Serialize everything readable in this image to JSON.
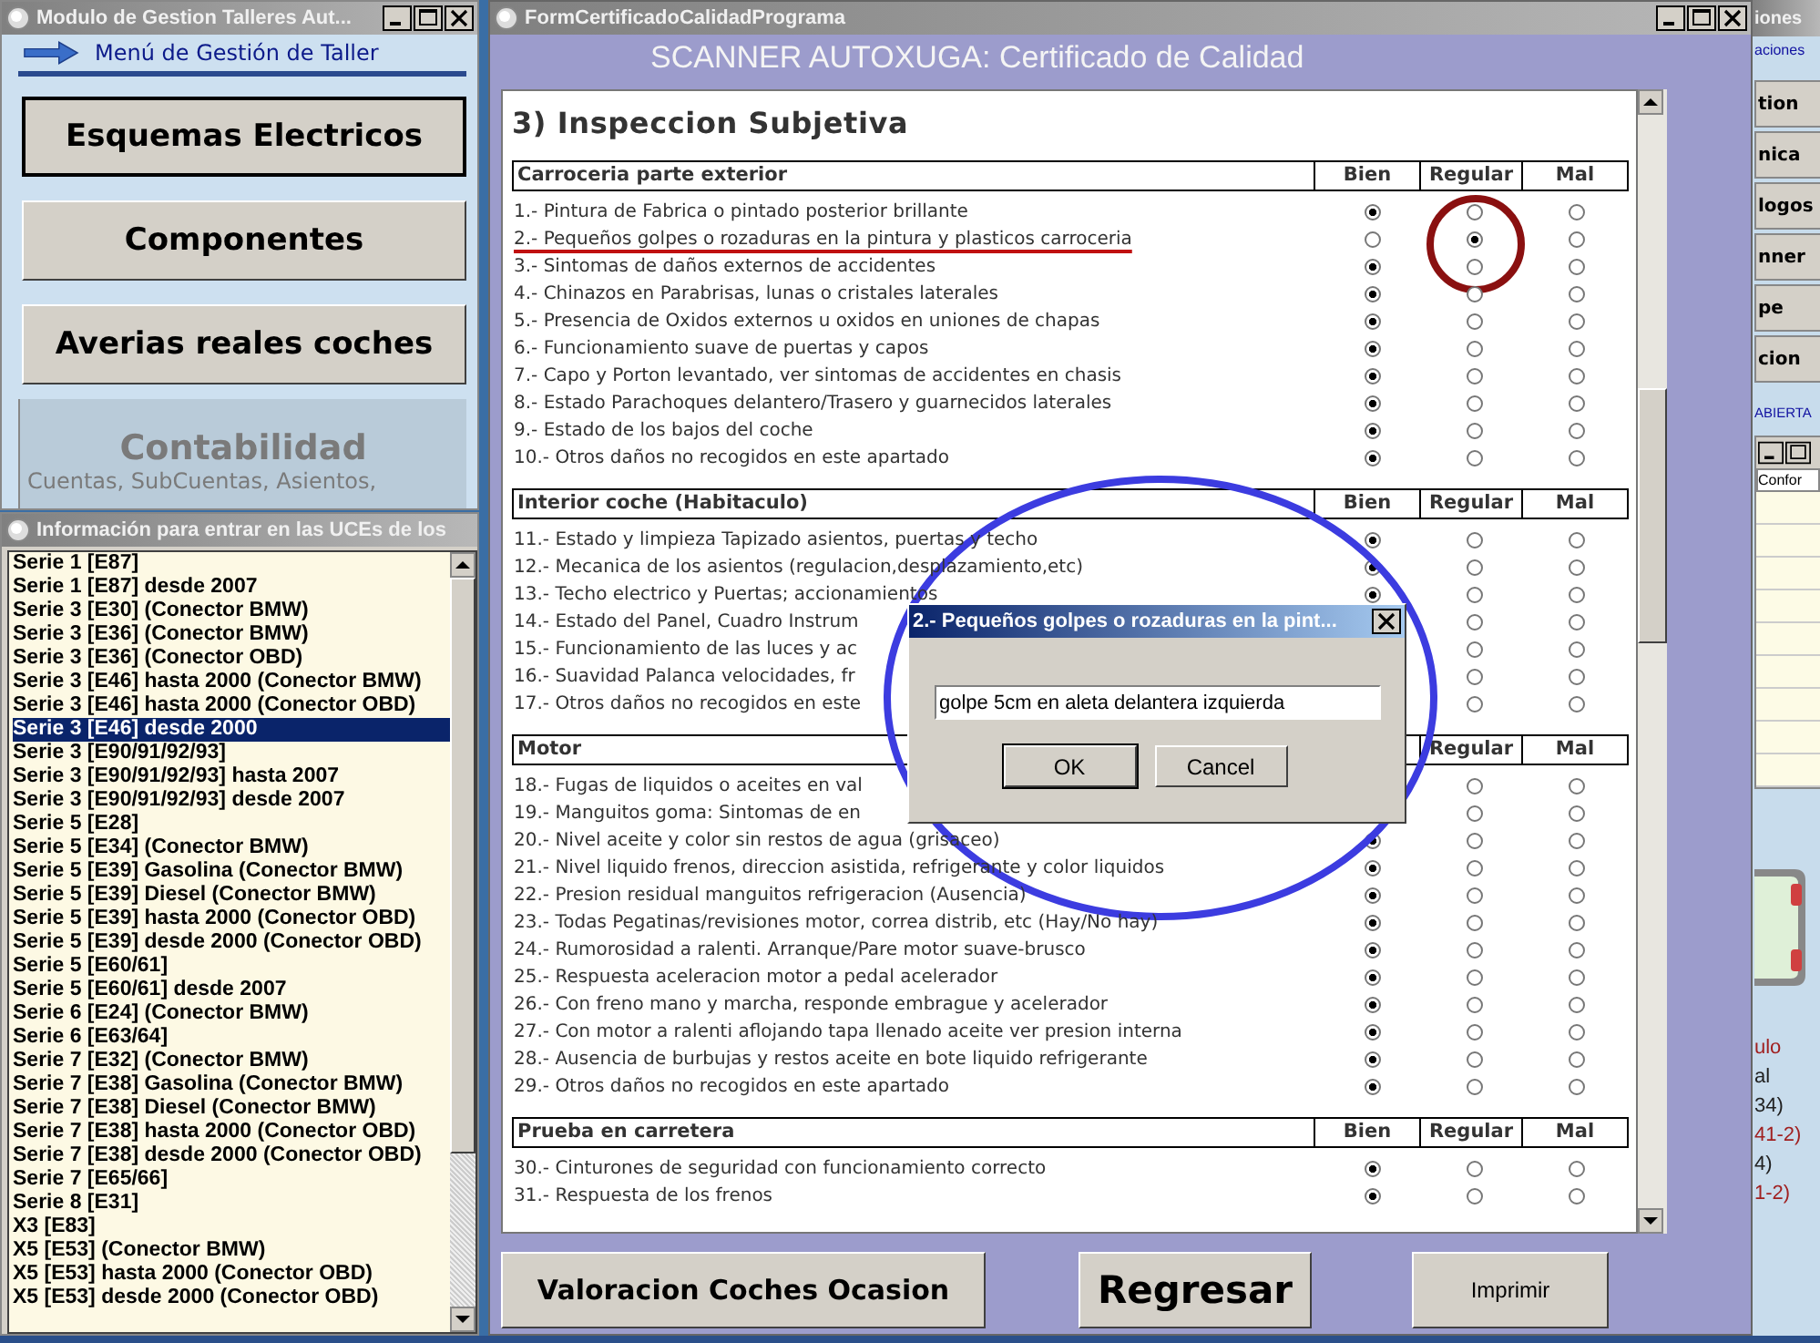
{
  "menu_window": {
    "title": "Modulo de Gestion Talleres Aut...",
    "heading": "Menú de Gestión de Taller",
    "buttons": [
      "Esquemas Electricos",
      "Componentes",
      "Averias reales coches"
    ],
    "section_title": "Contabilidad",
    "section_text": "Cuentas, SubCuentas, Asientos,"
  },
  "models_window": {
    "title": "Información para entrar en las UCEs de los",
    "items": [
      {
        "label": "Serie 1 [E87]",
        "selected": false
      },
      {
        "label": "Serie 1 [E87] desde 2007",
        "selected": false
      },
      {
        "label": "Serie 3 [E30] (Conector BMW)",
        "selected": false
      },
      {
        "label": "Serie 3 [E36] (Conector BMW)",
        "selected": false
      },
      {
        "label": "Serie 3 [E36] (Conector OBD)",
        "selected": false
      },
      {
        "label": "Serie 3 [E46] hasta 2000 (Conector BMW)",
        "selected": false
      },
      {
        "label": "Serie 3 [E46] hasta 2000 (Conector OBD)",
        "selected": false
      },
      {
        "label": "Serie 3 [E46] desde 2000",
        "selected": true
      },
      {
        "label": "Serie 3 [E90/91/92/93]",
        "selected": false
      },
      {
        "label": "Serie 3 [E90/91/92/93] hasta 2007",
        "selected": false
      },
      {
        "label": "Serie 3 [E90/91/92/93] desde 2007",
        "selected": false
      },
      {
        "label": "Serie 5 [E28]",
        "selected": false
      },
      {
        "label": "Serie 5 [E34] (Conector BMW)",
        "selected": false
      },
      {
        "label": "Serie 5 [E39] Gasolina (Conector BMW)",
        "selected": false
      },
      {
        "label": "Serie 5 [E39] Diesel (Conector BMW)",
        "selected": false
      },
      {
        "label": "Serie 5 [E39] hasta 2000 (Conector OBD)",
        "selected": false
      },
      {
        "label": "Serie 5 [E39] desde 2000 (Conector OBD)",
        "selected": false
      },
      {
        "label": "Serie 5 [E60/61]",
        "selected": false
      },
      {
        "label": "Serie 5 [E60/61] desde 2007",
        "selected": false
      },
      {
        "label": "Serie 6 [E24] (Conector BMW)",
        "selected": false
      },
      {
        "label": "Serie 6 [E63/64]",
        "selected": false
      },
      {
        "label": "Serie 7 [E32] (Conector BMW)",
        "selected": false
      },
      {
        "label": "Serie 7 [E38] Gasolina (Conector BMW)",
        "selected": false
      },
      {
        "label": "Serie 7 [E38] Diesel (Conector BMW)",
        "selected": false
      },
      {
        "label": "Serie 7 [E38] hasta 2000 (Conector OBD)",
        "selected": false
      },
      {
        "label": "Serie 7 [E38] desde 2000 (Conector OBD)",
        "selected": false
      },
      {
        "label": "Serie 7 [E65/66]",
        "selected": false
      },
      {
        "label": "Serie 8 [E31]",
        "selected": false
      },
      {
        "label": "X3 [E83]",
        "selected": false
      },
      {
        "label": "X5 [E53] (Conector BMW)",
        "selected": false
      },
      {
        "label": "X5 [E53] hasta 2000 (Conector OBD)",
        "selected": false
      },
      {
        "label": "X5 [E53] desde 2000 (Conector OBD)",
        "selected": false
      }
    ]
  },
  "certificate_window": {
    "title": "FormCertificadoCalidadPrograma",
    "header": "SCANNER AUTOXUGA: Certificado de Calidad",
    "heading": "3) Inspeccion Subjetiva",
    "sections": [
      {
        "title": "Carroceria parte exterior",
        "columns": [
          "Bien",
          "Regular",
          "Mal"
        ],
        "rows": [
          {
            "text": "1.- Pintura de Fabrica o pintado posterior brillante",
            "radios": {
              "bien": {
                "checked": true
              },
              "regular": {
                "checked": false
              },
              "mal": {
                "checked": false
              }
            }
          },
          {
            "text": "2.- Pequeños golpes o rozaduras en la pintura y plasticos carroceria",
            "radios": {
              "bien": {
                "checked": false
              },
              "regular": {
                "checked": true
              },
              "mal": {
                "checked": false
              }
            },
            "highlighted": true
          },
          {
            "text": "3.- Sintomas de daños externos de accidentes",
            "radios": {
              "bien": {
                "checked": true
              },
              "regular": {
                "checked": false
              },
              "mal": {
                "checked": false
              }
            }
          },
          {
            "text": "4.- Chinazos en Parabrisas, lunas o cristales laterales",
            "radios": {
              "bien": {
                "checked": true
              },
              "regular": {
                "checked": false
              },
              "mal": {
                "checked": false
              }
            }
          },
          {
            "text": "5.- Presencia de Oxidos externos u oxidos en uniones de chapas",
            "radios": {
              "bien": {
                "checked": true
              },
              "regular": {
                "checked": false
              },
              "mal": {
                "checked": false
              }
            }
          },
          {
            "text": "6.- Funcionamiento suave de puertas y capos",
            "radios": {
              "bien": {
                "checked": true
              },
              "regular": {
                "checked": false
              },
              "mal": {
                "checked": false
              }
            }
          },
          {
            "text": "7.- Capo y Porton levantado, ver sintomas de accidentes en chasis",
            "radios": {
              "bien": {
                "checked": true
              },
              "regular": {
                "checked": false
              },
              "mal": {
                "checked": false
              }
            }
          },
          {
            "text": "8.- Estado Parachoques delantero/Trasero y guarnecidos laterales",
            "radios": {
              "bien": {
                "checked": true
              },
              "regular": {
                "checked": false
              },
              "mal": {
                "checked": false
              }
            }
          },
          {
            "text": "9.- Estado de los bajos del coche",
            "radios": {
              "bien": {
                "checked": true
              },
              "regular": {
                "checked": false
              },
              "mal": {
                "checked": false
              }
            }
          },
          {
            "text": "10.- Otros daños no recogidos en este apartado",
            "radios": {
              "bien": {
                "checked": true
              },
              "regular": {
                "checked": false
              },
              "mal": {
                "checked": false
              }
            }
          }
        ]
      },
      {
        "title": "Interior coche (Habitaculo)",
        "columns": [
          "Bien",
          "Regular",
          "Mal"
        ],
        "rows": [
          {
            "text": "11.- Estado y limpieza Tapizado asientos, puertas y techo",
            "radios": {
              "bien": {
                "checked": true
              },
              "regular": {
                "checked": false
              },
              "mal": {
                "checked": false
              }
            }
          },
          {
            "text": "12.- Mecanica de los asientos (regulacion,desplazamiento,etc)",
            "radios": {
              "bien": {
                "checked": true
              },
              "regular": {
                "checked": false
              },
              "mal": {
                "checked": false
              }
            }
          },
          {
            "text": "13.- Techo electrico y Puertas; accionamientos",
            "radios": {
              "bien": {
                "checked": true
              },
              "regular": {
                "checked": false
              },
              "mal": {
                "checked": false
              }
            }
          },
          {
            "text": "14.- Estado del Panel, Cuadro Instrum",
            "radios": {
              "regular": {
                "checked": false
              },
              "mal": {
                "checked": false
              }
            }
          },
          {
            "text": "15.- Funcionamiento de las luces y ac",
            "radios": {
              "regular": {
                "checked": false
              },
              "mal": {
                "checked": false
              }
            }
          },
          {
            "text": "16.- Suavidad Palanca velocidades, fr",
            "radios": {
              "regular": {
                "checked": false
              },
              "mal": {
                "checked": false
              }
            }
          },
          {
            "text": "17.- Otros daños no recogidos en este",
            "radios": {
              "regular": {
                "checked": false
              },
              "mal": {
                "checked": false
              }
            }
          }
        ]
      },
      {
        "title": "Motor",
        "columns": [
          "Regular",
          "Mal"
        ],
        "rows": [
          {
            "text": "18.- Fugas de liquidos o aceites en val",
            "radios": {
              "regular": {
                "checked": false
              },
              "mal": {
                "checked": false
              }
            }
          },
          {
            "text": "19.- Manguitos goma: Sintomas de en",
            "radios": {
              "regular": {
                "checked": false
              },
              "mal": {
                "checked": false
              }
            }
          },
          {
            "text": "20.- Nivel aceite y color sin restos de agua (grisaceo)",
            "radios": {
              "bien": {
                "checked": true
              },
              "regular": {
                "checked": false
              },
              "mal": {
                "checked": false
              }
            }
          },
          {
            "text": "21.- Nivel liquido frenos, direccion asistida, refrigerante y color liquidos",
            "radios": {
              "bien": {
                "checked": true
              },
              "regular": {
                "checked": false
              },
              "mal": {
                "checked": false
              }
            }
          },
          {
            "text": "22.- Presion residual manguitos refrigeracion (Ausencia)",
            "radios": {
              "bien": {
                "checked": true
              },
              "regular": {
                "checked": false
              },
              "mal": {
                "checked": false
              }
            }
          },
          {
            "text": "23.- Todas Pegatinas/revisiones motor, correa distrib, etc (Hay/No hay)",
            "radios": {
              "bien": {
                "checked": true
              },
              "regular": {
                "checked": false
              },
              "mal": {
                "checked": false
              }
            }
          },
          {
            "text": "24.- Rumorosidad a ralenti. Arranque/Pare motor suave-brusco",
            "radios": {
              "bien": {
                "checked": true
              },
              "regular": {
                "checked": false
              },
              "mal": {
                "checked": false
              }
            }
          },
          {
            "text": "25.- Respuesta aceleracion motor a pedal acelerador",
            "radios": {
              "bien": {
                "checked": true
              },
              "regular": {
                "checked": false
              },
              "mal": {
                "checked": false
              }
            }
          },
          {
            "text": "26.- Con freno mano y marcha, responde embrague y acelerador",
            "radios": {
              "bien": {
                "checked": true
              },
              "regular": {
                "checked": false
              },
              "mal": {
                "checked": false
              }
            }
          },
          {
            "text": "27.- Con motor a ralenti aflojando tapa llenado aceite ver presion interna",
            "radios": {
              "bien": {
                "checked": true
              },
              "regular": {
                "checked": false
              },
              "mal": {
                "checked": false
              }
            }
          },
          {
            "text": "28.- Ausencia de burbujas y restos aceite en bote liquido refrigerante",
            "radios": {
              "bien": {
                "checked": true
              },
              "regular": {
                "checked": false
              },
              "mal": {
                "checked": false
              }
            }
          },
          {
            "text": "29.- Otros daños no recogidos en este apartado",
            "radios": {
              "bien": {
                "checked": true
              },
              "regular": {
                "checked": false
              },
              "mal": {
                "checked": false
              }
            }
          }
        ]
      },
      {
        "title": "Prueba en carretera",
        "columns": [
          "Bien",
          "Regular",
          "Mal"
        ],
        "rows": [
          {
            "text": "30.- Cinturones de seguridad con funcionamiento correcto",
            "radios": {
              "bien": {
                "checked": true
              },
              "regular": {
                "checked": false
              },
              "mal": {
                "checked": false
              }
            }
          },
          {
            "text": "31.- Respuesta de los frenos",
            "radios": {
              "bien": {
                "checked": true
              },
              "regular": {
                "checked": false
              },
              "mal": {
                "checked": false
              }
            }
          }
        ]
      }
    ],
    "buttons": [
      {
        "label": "Valoracion Coches Ocasion",
        "kind": "medium"
      },
      {
        "label": "Regresar",
        "kind": "large"
      },
      {
        "label": "Imprimir",
        "kind": "small"
      }
    ]
  },
  "dialog": {
    "title": "2.- Pequeños golpes o rozaduras en la pint...",
    "value": "golpe 5cm en aleta delantera izquierda",
    "buttons": [
      "OK",
      "Cancel"
    ]
  },
  "background_window": {
    "title": "iones",
    "link": "aciones",
    "buttons": [
      "tion",
      "nica",
      "logos",
      "nner",
      "pe",
      "cion"
    ],
    "status": "ABIERTA",
    "column": "Confor",
    "notes": [
      {
        "text": "ulo",
        "color": "#a02020"
      },
      {
        "text": "al",
        "color": "#202020"
      },
      {
        "text": "34)",
        "color": "#202020"
      },
      {
        "text": "41-2)",
        "color": "#a02020"
      },
      {
        "text": "4)",
        "color": "#202020"
      },
      {
        "text": "1-2)",
        "color": "#a02020"
      }
    ]
  }
}
